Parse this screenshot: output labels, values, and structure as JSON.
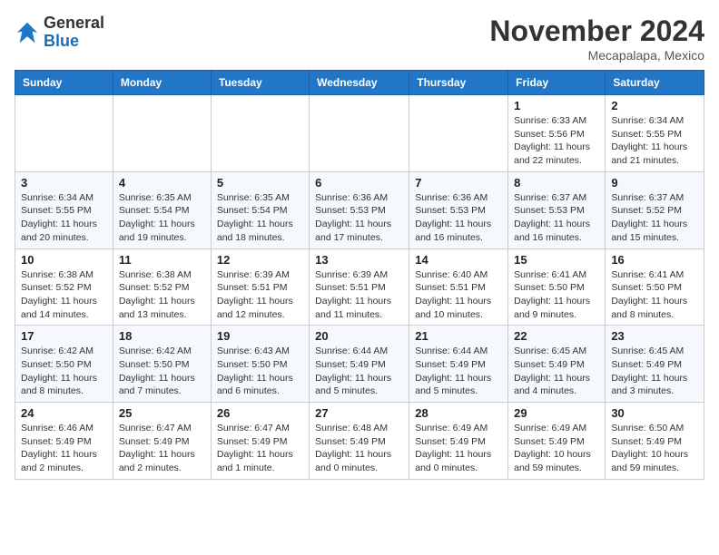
{
  "logo": {
    "general": "General",
    "blue": "Blue"
  },
  "header": {
    "month": "November 2024",
    "location": "Mecapalapa, Mexico"
  },
  "days_of_week": [
    "Sunday",
    "Monday",
    "Tuesday",
    "Wednesday",
    "Thursday",
    "Friday",
    "Saturday"
  ],
  "weeks": [
    [
      {
        "day": "",
        "info": ""
      },
      {
        "day": "",
        "info": ""
      },
      {
        "day": "",
        "info": ""
      },
      {
        "day": "",
        "info": ""
      },
      {
        "day": "",
        "info": ""
      },
      {
        "day": "1",
        "info": "Sunrise: 6:33 AM\nSunset: 5:56 PM\nDaylight: 11 hours and 22 minutes."
      },
      {
        "day": "2",
        "info": "Sunrise: 6:34 AM\nSunset: 5:55 PM\nDaylight: 11 hours and 21 minutes."
      }
    ],
    [
      {
        "day": "3",
        "info": "Sunrise: 6:34 AM\nSunset: 5:55 PM\nDaylight: 11 hours and 20 minutes."
      },
      {
        "day": "4",
        "info": "Sunrise: 6:35 AM\nSunset: 5:54 PM\nDaylight: 11 hours and 19 minutes."
      },
      {
        "day": "5",
        "info": "Sunrise: 6:35 AM\nSunset: 5:54 PM\nDaylight: 11 hours and 18 minutes."
      },
      {
        "day": "6",
        "info": "Sunrise: 6:36 AM\nSunset: 5:53 PM\nDaylight: 11 hours and 17 minutes."
      },
      {
        "day": "7",
        "info": "Sunrise: 6:36 AM\nSunset: 5:53 PM\nDaylight: 11 hours and 16 minutes."
      },
      {
        "day": "8",
        "info": "Sunrise: 6:37 AM\nSunset: 5:53 PM\nDaylight: 11 hours and 16 minutes."
      },
      {
        "day": "9",
        "info": "Sunrise: 6:37 AM\nSunset: 5:52 PM\nDaylight: 11 hours and 15 minutes."
      }
    ],
    [
      {
        "day": "10",
        "info": "Sunrise: 6:38 AM\nSunset: 5:52 PM\nDaylight: 11 hours and 14 minutes."
      },
      {
        "day": "11",
        "info": "Sunrise: 6:38 AM\nSunset: 5:52 PM\nDaylight: 11 hours and 13 minutes."
      },
      {
        "day": "12",
        "info": "Sunrise: 6:39 AM\nSunset: 5:51 PM\nDaylight: 11 hours and 12 minutes."
      },
      {
        "day": "13",
        "info": "Sunrise: 6:39 AM\nSunset: 5:51 PM\nDaylight: 11 hours and 11 minutes."
      },
      {
        "day": "14",
        "info": "Sunrise: 6:40 AM\nSunset: 5:51 PM\nDaylight: 11 hours and 10 minutes."
      },
      {
        "day": "15",
        "info": "Sunrise: 6:41 AM\nSunset: 5:50 PM\nDaylight: 11 hours and 9 minutes."
      },
      {
        "day": "16",
        "info": "Sunrise: 6:41 AM\nSunset: 5:50 PM\nDaylight: 11 hours and 8 minutes."
      }
    ],
    [
      {
        "day": "17",
        "info": "Sunrise: 6:42 AM\nSunset: 5:50 PM\nDaylight: 11 hours and 8 minutes."
      },
      {
        "day": "18",
        "info": "Sunrise: 6:42 AM\nSunset: 5:50 PM\nDaylight: 11 hours and 7 minutes."
      },
      {
        "day": "19",
        "info": "Sunrise: 6:43 AM\nSunset: 5:50 PM\nDaylight: 11 hours and 6 minutes."
      },
      {
        "day": "20",
        "info": "Sunrise: 6:44 AM\nSunset: 5:49 PM\nDaylight: 11 hours and 5 minutes."
      },
      {
        "day": "21",
        "info": "Sunrise: 6:44 AM\nSunset: 5:49 PM\nDaylight: 11 hours and 5 minutes."
      },
      {
        "day": "22",
        "info": "Sunrise: 6:45 AM\nSunset: 5:49 PM\nDaylight: 11 hours and 4 minutes."
      },
      {
        "day": "23",
        "info": "Sunrise: 6:45 AM\nSunset: 5:49 PM\nDaylight: 11 hours and 3 minutes."
      }
    ],
    [
      {
        "day": "24",
        "info": "Sunrise: 6:46 AM\nSunset: 5:49 PM\nDaylight: 11 hours and 2 minutes."
      },
      {
        "day": "25",
        "info": "Sunrise: 6:47 AM\nSunset: 5:49 PM\nDaylight: 11 hours and 2 minutes."
      },
      {
        "day": "26",
        "info": "Sunrise: 6:47 AM\nSunset: 5:49 PM\nDaylight: 11 hours and 1 minute."
      },
      {
        "day": "27",
        "info": "Sunrise: 6:48 AM\nSunset: 5:49 PM\nDaylight: 11 hours and 0 minutes."
      },
      {
        "day": "28",
        "info": "Sunrise: 6:49 AM\nSunset: 5:49 PM\nDaylight: 11 hours and 0 minutes."
      },
      {
        "day": "29",
        "info": "Sunrise: 6:49 AM\nSunset: 5:49 PM\nDaylight: 10 hours and 59 minutes."
      },
      {
        "day": "30",
        "info": "Sunrise: 6:50 AM\nSunset: 5:49 PM\nDaylight: 10 hours and 59 minutes."
      }
    ]
  ]
}
